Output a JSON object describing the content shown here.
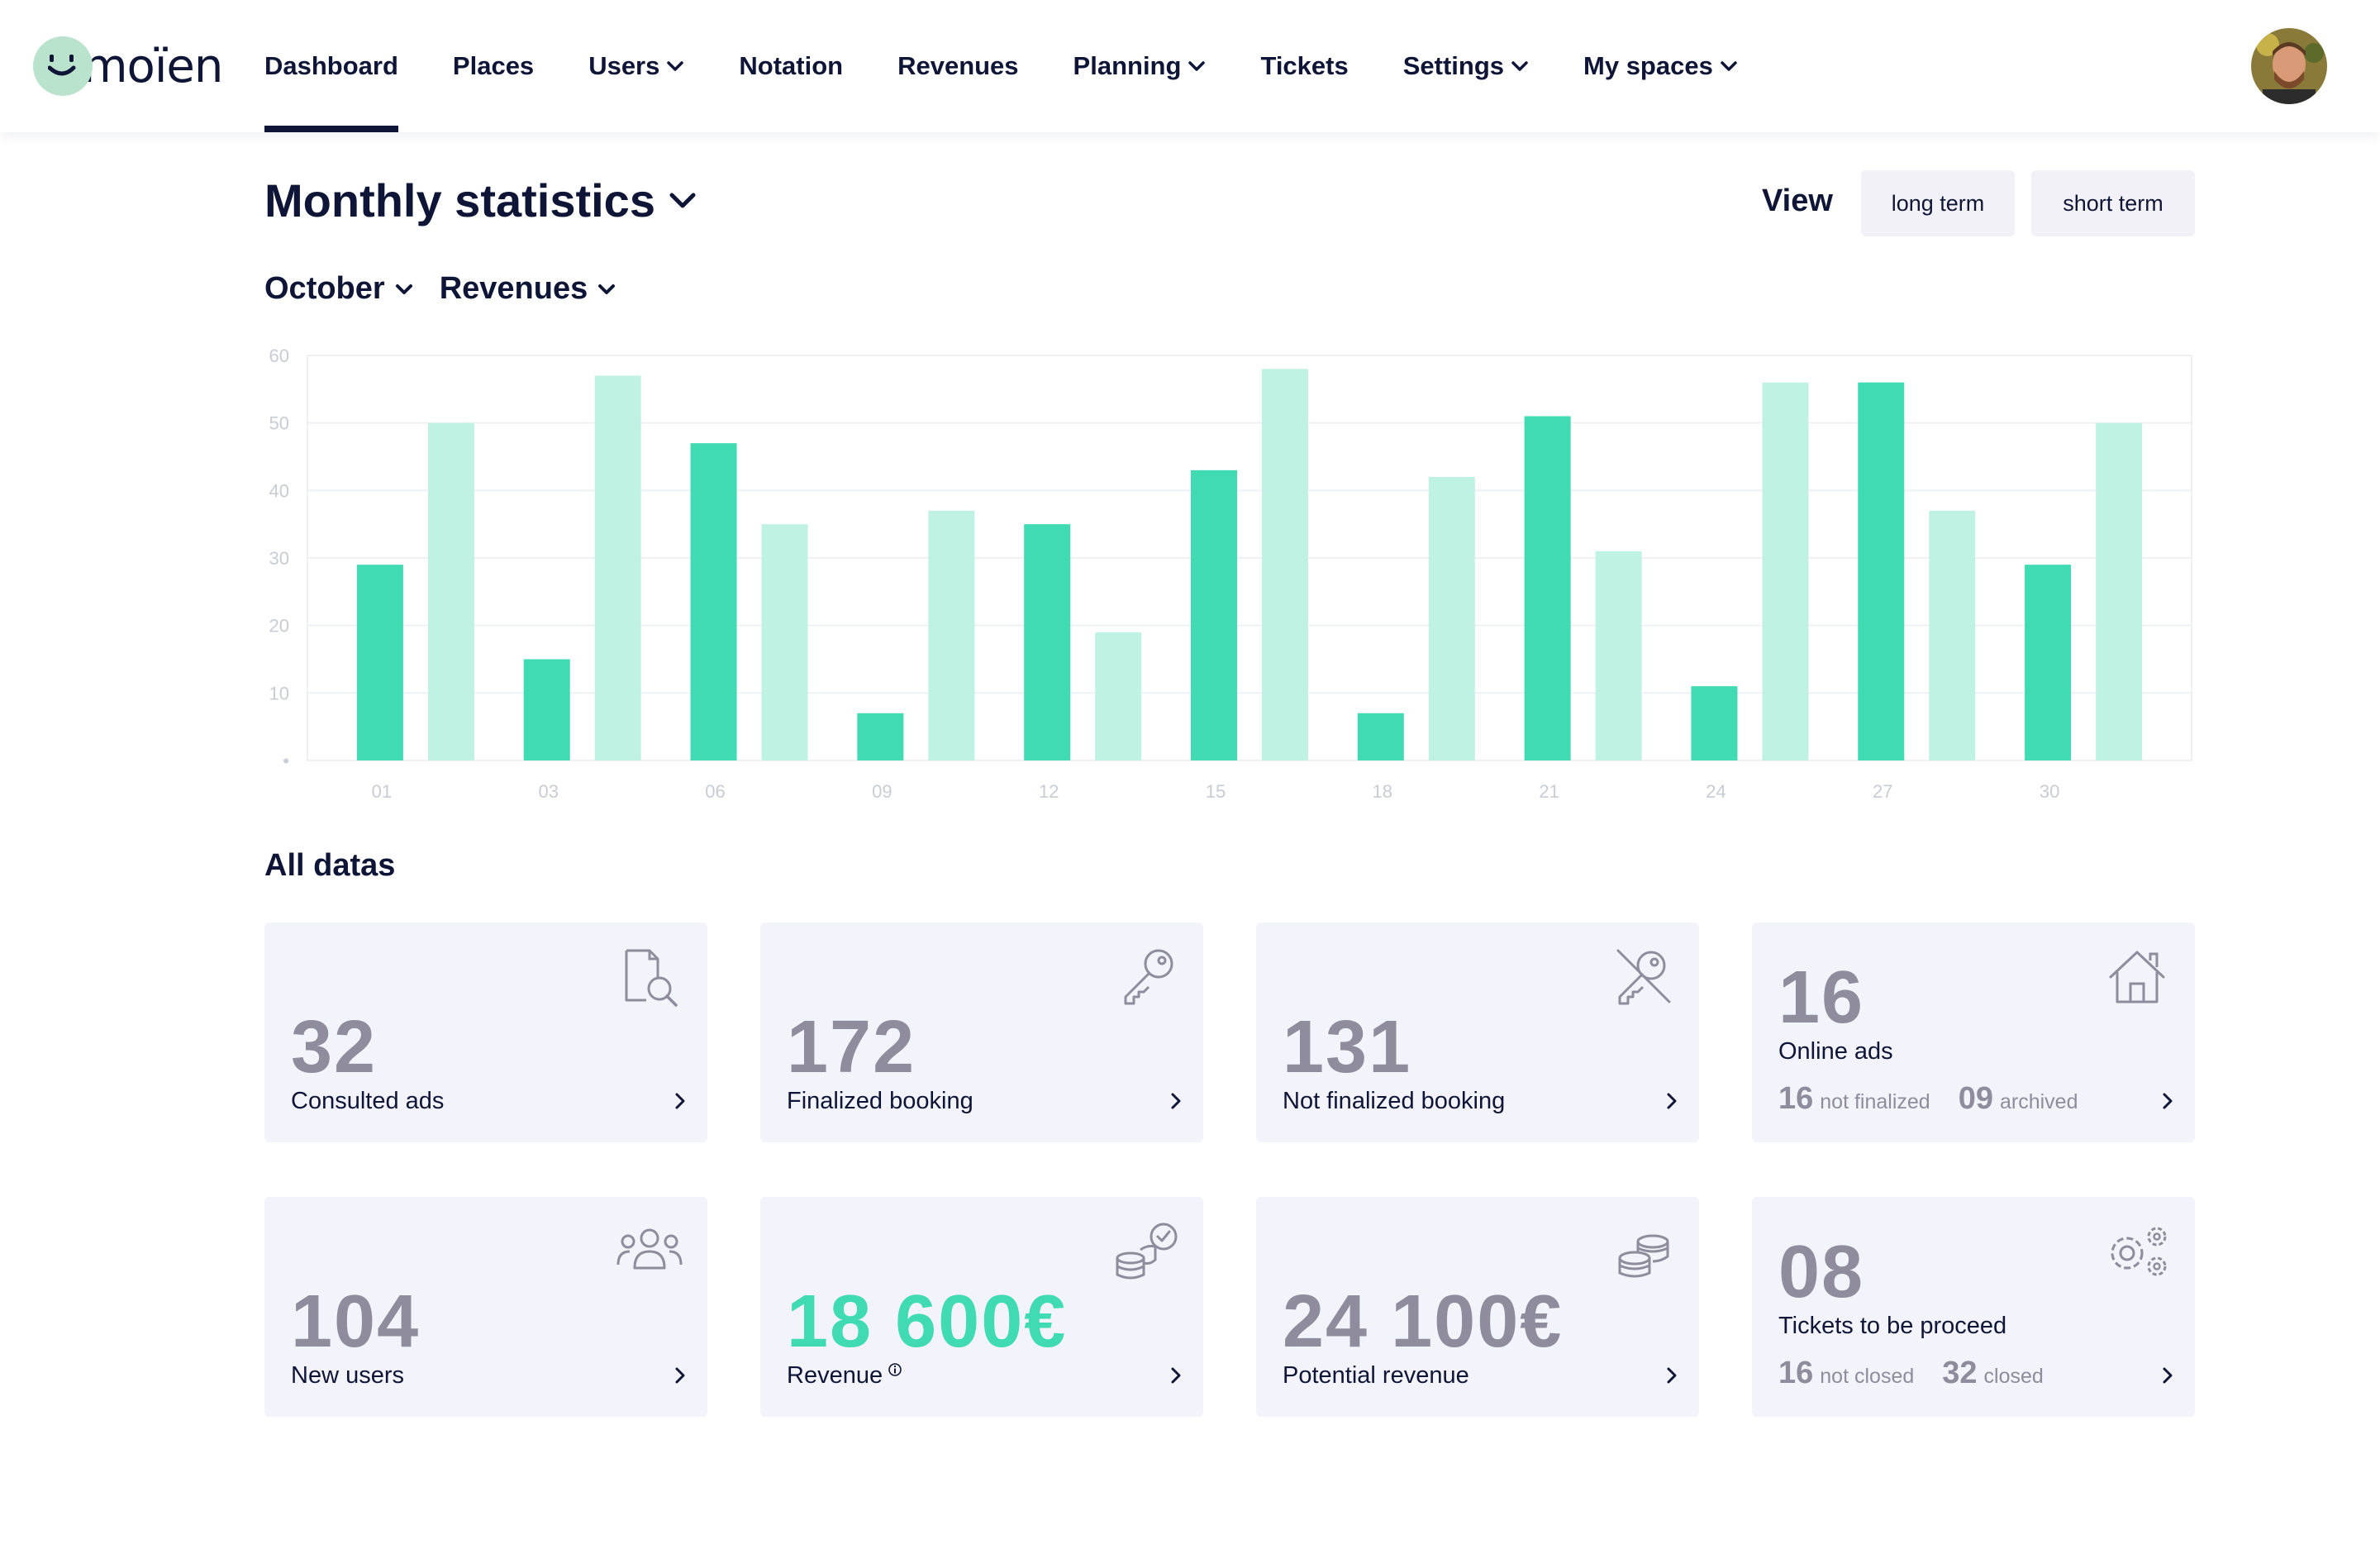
{
  "app": {
    "logo_text": "moïen"
  },
  "nav": {
    "items": [
      {
        "label": "Dashboard",
        "dropdown": false,
        "active": true
      },
      {
        "label": "Places",
        "dropdown": false
      },
      {
        "label": "Users",
        "dropdown": true
      },
      {
        "label": "Notation",
        "dropdown": false
      },
      {
        "label": "Revenues",
        "dropdown": false
      },
      {
        "label": "Planning",
        "dropdown": true
      },
      {
        "label": "Tickets",
        "dropdown": false
      },
      {
        "label": "Settings",
        "dropdown": true
      },
      {
        "label": "My spaces",
        "dropdown": true
      }
    ]
  },
  "header": {
    "title": "Monthly statistics",
    "view_label": "View",
    "long_term_label": "long term",
    "short_term_label": "short term"
  },
  "filters": {
    "month": "October",
    "metric": "Revenues"
  },
  "chart_data": {
    "type": "bar",
    "title": "",
    "xlabel": "",
    "ylabel": "",
    "ylim": [
      0,
      60
    ],
    "yticks": [
      "•",
      "10",
      "20",
      "30",
      "40",
      "50",
      "60"
    ],
    "xticks": [
      "01",
      "03",
      "06",
      "09",
      "12",
      "15",
      "18",
      "21",
      "24",
      "27",
      "30"
    ],
    "series": [
      {
        "values": [
          29,
          15,
          47,
          7,
          35,
          43,
          7,
          51,
          11,
          56,
          29
        ],
        "color": "#40dbb2"
      },
      {
        "values": [
          50,
          57,
          35,
          37,
          19,
          58,
          42,
          31,
          56,
          37,
          50
        ],
        "color": "#c0f2e4"
      }
    ],
    "grid": true,
    "legend": "none"
  },
  "stats": {
    "section_title": "All datas",
    "cards": [
      {
        "value": "32",
        "label": "Consulted ads",
        "icon": "document-search-icon"
      },
      {
        "value": "172",
        "label": "Finalized booking",
        "icon": "key-icon"
      },
      {
        "value": "131",
        "label": "Not finalized booking",
        "icon": "key-off-icon"
      },
      {
        "value": "16",
        "label": "Online ads",
        "icon": "house-icon",
        "sub": [
          {
            "value": "16",
            "label": "not finalized"
          },
          {
            "value": "09",
            "label": "archived"
          }
        ]
      },
      {
        "value": "104",
        "label": "New users",
        "icon": "users-icon"
      },
      {
        "value": "18 600€",
        "label": "Revenue",
        "icon": "coins-check-icon",
        "accent": "#40dbb2"
      },
      {
        "value": "24 100€",
        "label": "Potential revenue",
        "icon": "coins-icon"
      },
      {
        "value": "08",
        "label": "Tickets to be proceed",
        "icon": "gears-icon",
        "sub": [
          {
            "value": "16",
            "label": "not closed"
          },
          {
            "value": "32",
            "label": "closed"
          }
        ]
      }
    ]
  },
  "colors": {
    "primary": "#0f1536",
    "accent": "#40dbb2",
    "accent_light": "#c0f2e4",
    "card_bg": "#f3f3fb",
    "muted": "#8e8c9d"
  }
}
